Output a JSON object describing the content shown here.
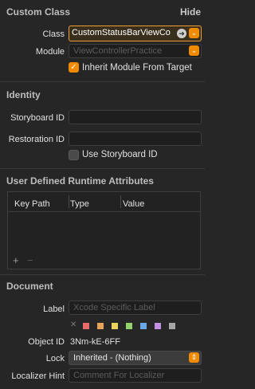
{
  "custom_class": {
    "title": "Custom Class",
    "hide": "Hide",
    "class_label": "Class",
    "class_value": "CustomStatusBarViewCo",
    "module_label": "Module",
    "module_placeholder": "ViewControllerPractice",
    "inherit_label": "Inherit Module From Target",
    "inherit_checked": true
  },
  "identity": {
    "title": "Identity",
    "storyboard_id_label": "Storyboard ID",
    "storyboard_id_value": "",
    "restoration_id_label": "Restoration ID",
    "restoration_id_value": "",
    "use_storyboard_id_label": "Use Storyboard ID",
    "use_storyboard_id_checked": false
  },
  "runtime_attributes": {
    "title": "User Defined Runtime Attributes",
    "columns": [
      "Key Path",
      "Type",
      "Value"
    ],
    "add_symbol": "+",
    "remove_symbol": "−"
  },
  "document": {
    "title": "Document",
    "label_label": "Label",
    "label_placeholder": "Xcode Specific Label",
    "clear_symbol": "✕",
    "color_swatches": [
      "#e86a6a",
      "#e8a25a",
      "#e8d45a",
      "#8fd36a",
      "#6aa9e8",
      "#c38fe0",
      "#a6a6a6"
    ],
    "object_id_label": "Object ID",
    "object_id_value": "3Nm-kE-6FF",
    "lock_label": "Lock",
    "lock_value": "Inherited - (Nothing)",
    "localizer_label": "Localizer Hint",
    "localizer_placeholder": "Comment For Localizer"
  },
  "colors": {
    "accent": "#f08a00",
    "background": "#262626",
    "class_field_border": "#f0a030"
  }
}
